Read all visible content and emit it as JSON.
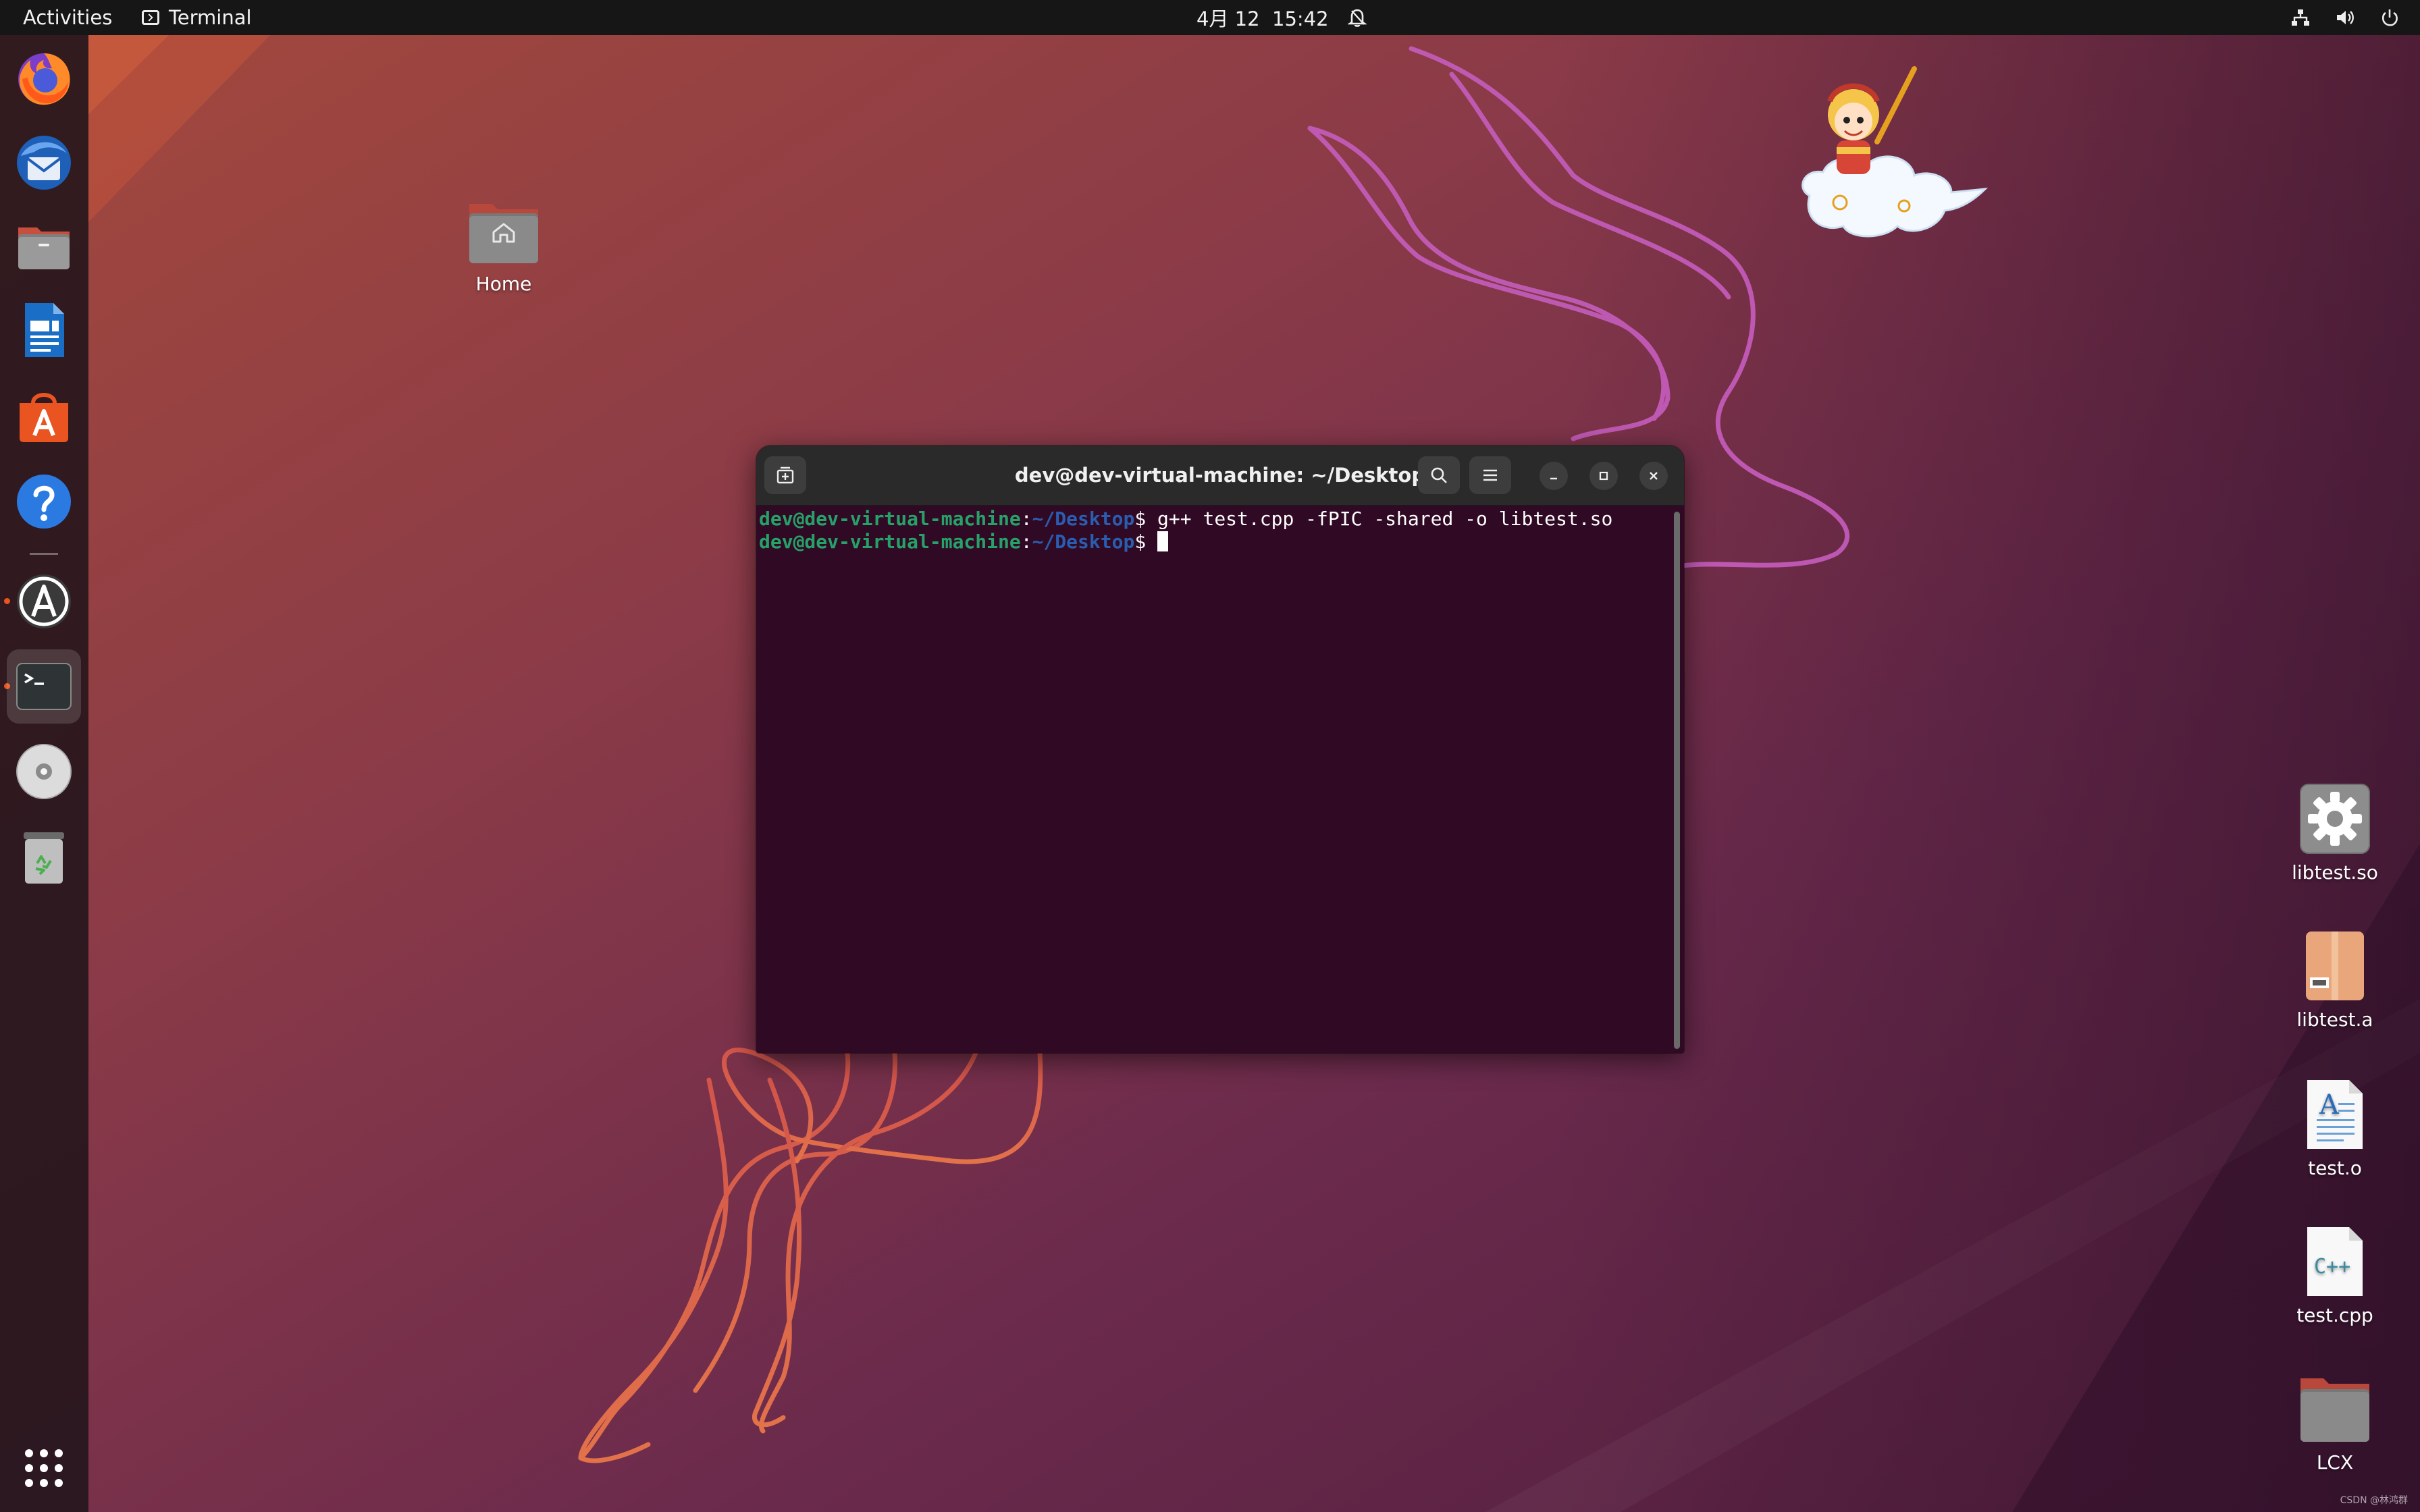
{
  "topbar": {
    "activities_label": "Activities",
    "app_name": "Terminal",
    "date": "4月 12",
    "time": "15:42",
    "icons": [
      "bell-icon",
      "network-icon",
      "volume-icon",
      "power-icon"
    ]
  },
  "dock": {
    "items": [
      {
        "name": "firefox",
        "icon": "firefox-icon",
        "running": false
      },
      {
        "name": "thunderbird",
        "icon": "thunderbird-icon",
        "running": false
      },
      {
        "name": "files",
        "icon": "files-icon",
        "running": false
      },
      {
        "name": "libreoffice-writer",
        "icon": "writer-icon",
        "running": false
      },
      {
        "name": "app-center",
        "icon": "app-center-icon",
        "running": false
      },
      {
        "name": "help",
        "icon": "help-icon",
        "running": false
      },
      {
        "name": "software-updater",
        "icon": "updater-icon",
        "running": true
      },
      {
        "name": "terminal",
        "icon": "terminal-icon",
        "running": true,
        "active": true
      },
      {
        "name": "disc",
        "icon": "disc-icon",
        "running": false
      },
      {
        "name": "trash",
        "icon": "trash-icon",
        "running": false
      }
    ],
    "apps_grid_icon": "apps-grid-icon"
  },
  "desktop": {
    "home_label": "Home",
    "files": [
      {
        "label": "libtest.so",
        "icon": "gear-file-icon"
      },
      {
        "label": "libtest.a",
        "icon": "archive-file-icon"
      },
      {
        "label": "test.o",
        "icon": "text-file-icon"
      },
      {
        "label": "test.cpp",
        "icon": "cpp-file-icon"
      },
      {
        "label": "LCX",
        "icon": "folder-icon"
      }
    ]
  },
  "terminal": {
    "title": "dev@dev-virtual-machine: ~/Desktop",
    "lines": [
      {
        "user": "dev@dev-virtual-machine",
        "colon": ":",
        "path": "~/Desktop",
        "dollar": "$",
        "command": " g++ test.cpp -fPIC -shared -o libtest.so"
      },
      {
        "user": "dev@dev-virtual-machine",
        "colon": ":",
        "path": "~/Desktop",
        "dollar": "$",
        "command": " "
      }
    ]
  },
  "watermark": "CSDN @林鸿群",
  "colors": {
    "accent": "#e95420",
    "terminal_bg": "#300a24",
    "prompt_user": "#26a269",
    "prompt_path": "#2a5db0"
  }
}
